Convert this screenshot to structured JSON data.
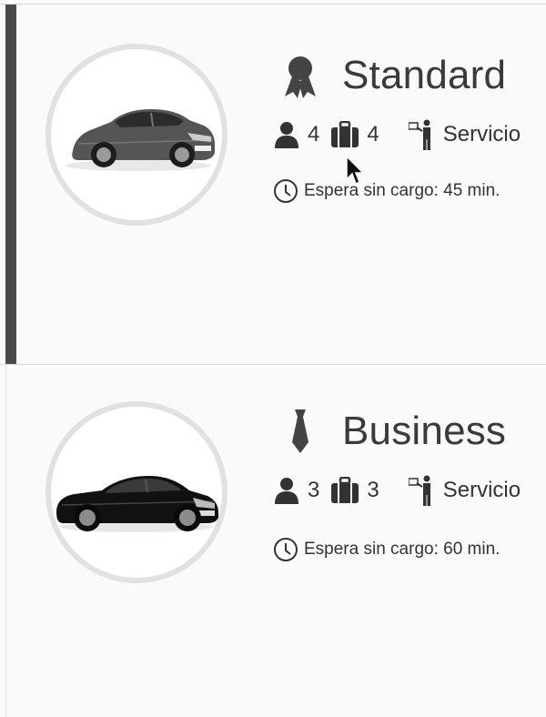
{
  "services": [
    {
      "name": "Standard",
      "icon": "award-ribbon-icon",
      "passengers": "4",
      "luggage": "4",
      "service_label": "Servicio",
      "wait_text": "Espera sin cargo: 45 min.",
      "selected": true,
      "car_image": "silver-hybrid-sedan"
    },
    {
      "name": "Business",
      "icon": "necktie-icon",
      "passengers": "3",
      "luggage": "3",
      "service_label": "Servicio",
      "wait_text": "Espera sin cargo: 60 min.",
      "selected": false,
      "car_image": "black-executive-sedan"
    }
  ],
  "colors": {
    "selected_bar": "#4a4a4a",
    "circle_border": "#e1e1e1",
    "text": "#333333",
    "background": "#fafafa"
  }
}
